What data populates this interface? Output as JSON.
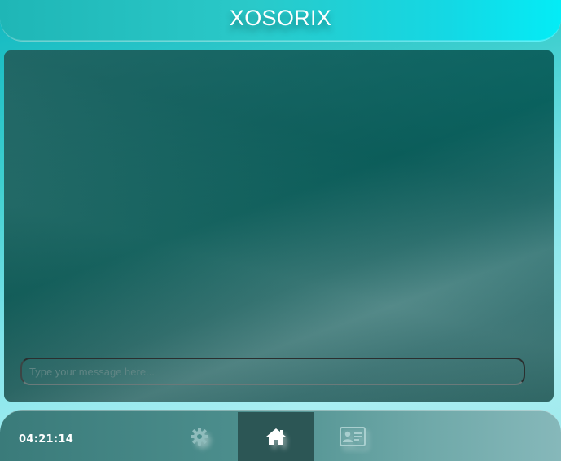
{
  "header": {
    "title": "XOSORIX"
  },
  "chat": {
    "input_placeholder": "Type your message here..."
  },
  "footer": {
    "time": "04:21:14",
    "nav": [
      {
        "name": "settings",
        "icon": "gear-icon",
        "active": false
      },
      {
        "name": "home",
        "icon": "home-icon",
        "active": true
      },
      {
        "name": "profile",
        "icon": "id-card-icon",
        "active": false
      }
    ]
  },
  "colors": {
    "header_start": "#1fb6b6",
    "header_end": "#04ecf6",
    "panel": "#1b6461",
    "footer": "#4d8f8e",
    "active_nav": "#2c5655",
    "text": "#ffffff"
  }
}
